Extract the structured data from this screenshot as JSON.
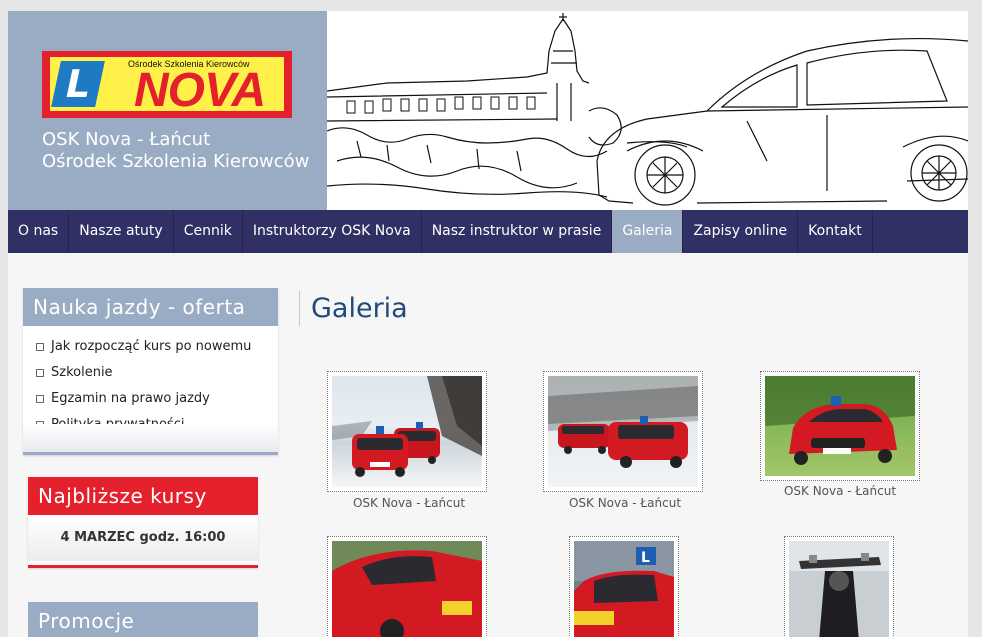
{
  "brand": {
    "logo_small": "Ośrodek Szkolenia Kierowców",
    "logo_letter": "L",
    "logo_name": "NOVA",
    "title_line1": "OSK Nova - Łańcut",
    "title_line2": "Ośrodek Szkolenia Kierowców"
  },
  "nav": [
    {
      "label": "O nas"
    },
    {
      "label": "Nasze atuty"
    },
    {
      "label": "Cennik"
    },
    {
      "label": "Instruktorzy OSK Nova"
    },
    {
      "label": "Nasz instruktor w prasie"
    },
    {
      "label": "Galeria",
      "active": true
    },
    {
      "label": "Zapisy online"
    },
    {
      "label": "Kontakt"
    }
  ],
  "sidebar": {
    "offer_title": "Nauka jazdy - oferta",
    "offer_items": [
      "Jak rozpocząć kurs po nowemu",
      "Szkolenie",
      "Egzamin na prawo jazdy",
      "Polityka prywatności"
    ],
    "courses_title": "Najbliższe kursy",
    "courses_date": "4 MARZEC godz. 16:00",
    "promo_title": "Promocje"
  },
  "content": {
    "title": "Galeria",
    "captions": [
      "OSK Nova - Łańcut",
      "OSK Nova - Łańcut",
      "OSK Nova - Łańcut"
    ]
  },
  "colors": {
    "accent": "#9aacc4",
    "nav": "#303064",
    "red": "#e3202c",
    "title": "#1e4b7a"
  }
}
